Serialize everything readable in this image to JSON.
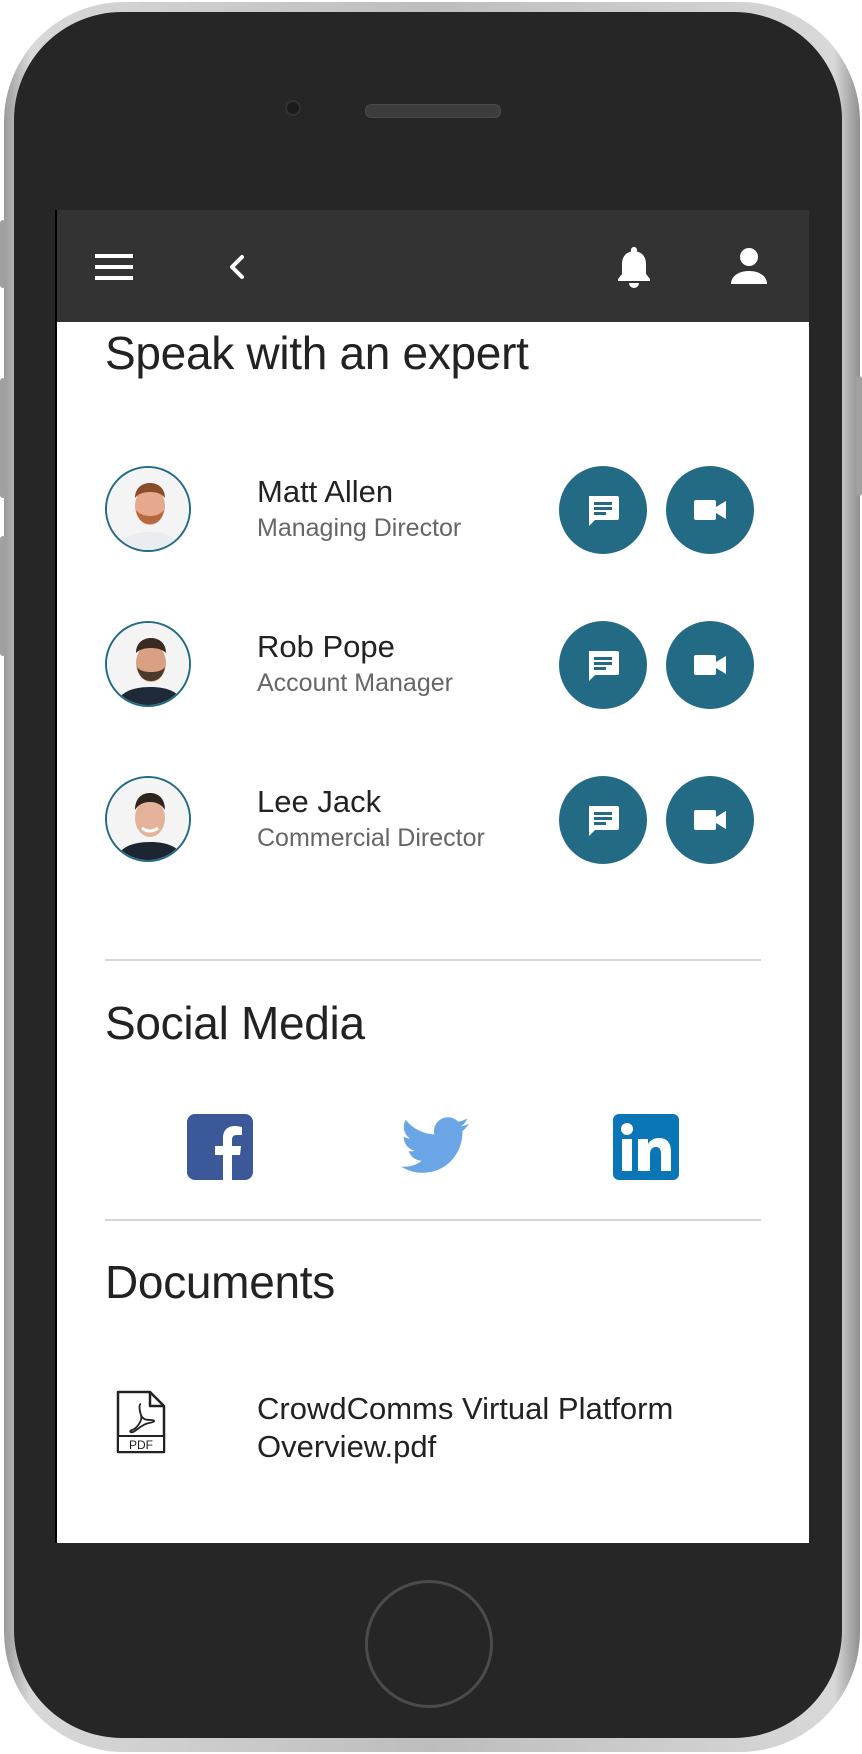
{
  "header": {
    "menu_icon": "hamburger-menu-icon",
    "back_icon": "chevron-left-icon",
    "notifications_icon": "bell-icon",
    "profile_icon": "user-icon"
  },
  "experts": {
    "title": "Speak with an expert",
    "people": [
      {
        "name": "Matt Allen",
        "role": "Managing Director"
      },
      {
        "name": "Rob Pope",
        "role": "Account Manager"
      },
      {
        "name": "Lee Jack",
        "role": "Commercial Director"
      }
    ]
  },
  "social": {
    "title": "Social Media",
    "links": [
      "facebook",
      "twitter",
      "linkedin"
    ]
  },
  "documents": {
    "title": "Documents",
    "items": [
      {
        "name": "CrowdComms Virtual Platform Overview.pdf",
        "icon_label": "PDF"
      }
    ]
  },
  "colors": {
    "accent": "#236b85",
    "topbar": "#333333",
    "facebook": "#3b5998",
    "twitter": "#6aa6e6",
    "linkedin": "#0a76b7"
  }
}
